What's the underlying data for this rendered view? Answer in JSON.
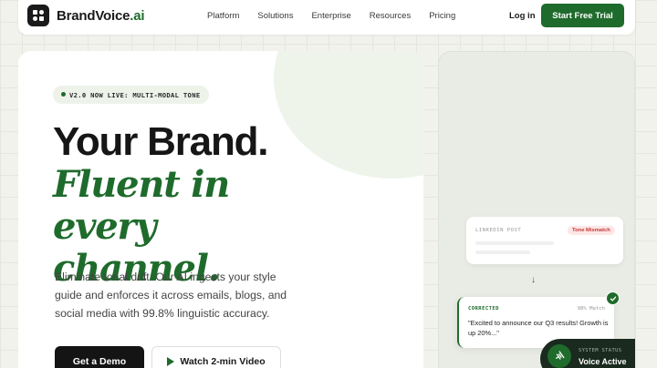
{
  "nav": {
    "brand": "BrandVoice",
    "brand_suffix": ".ai",
    "links": [
      "Platform",
      "Solutions",
      "Enterprise",
      "Resources",
      "Pricing"
    ],
    "login": "Log in",
    "cta": "Start Free Trial"
  },
  "hero": {
    "badge": "V2.0 NOW LIVE: MULTI-MODAL TONE",
    "title_line1": "Your Brand.",
    "title_italic": "Fluent in every channel.",
    "subtitle": "Eliminate tonal drift. Our AI ingests your style guide and enforces it across emails, blogs, and social media with 99.8% linguistic accuracy.",
    "primary_button": "Get a Demo",
    "secondary_button": "Watch 2-min Video"
  },
  "panel": {
    "linkedin_label": "LINKEDIN POST",
    "mismatch_badge": "Tone Mismatch",
    "corrected_label": "CORRECTED",
    "match_text": "98% Match",
    "corrected_quote": "\"Excited to announce our Q3 results! Growth is up 20%...\"",
    "status_caption": "SYSTEM STATUS",
    "status_value": "Voice Active"
  },
  "colors": {
    "brand_green": "#1f6b2c",
    "dark": "#141414",
    "mismatch_red": "#c63a3a"
  },
  "icons": [
    "logo-mark-icon",
    "play-icon",
    "arrow-down-icon",
    "check-icon",
    "waveform-icon"
  ]
}
